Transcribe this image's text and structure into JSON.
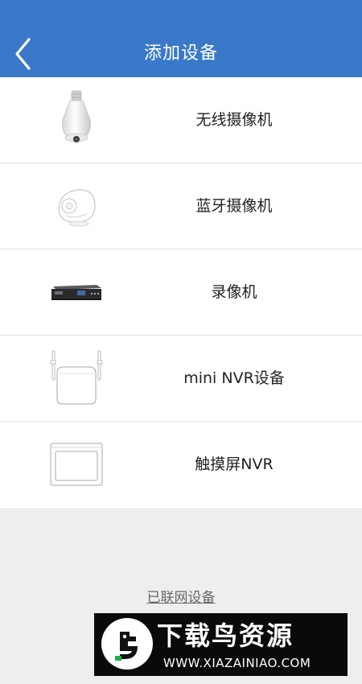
{
  "header": {
    "title": "添加设备",
    "back_icon": "chevron-left-icon",
    "background_color": "#3a79c9"
  },
  "devices": [
    {
      "label": "无线摄像机",
      "icon": "bulb-camera-icon"
    },
    {
      "label": "蓝牙摄像机",
      "icon": "dome-camera-icon"
    },
    {
      "label": "录像机",
      "icon": "dvr-recorder-icon"
    },
    {
      "label": "mini NVR设备",
      "icon": "mini-nvr-router-icon"
    },
    {
      "label": "触摸屏NVR",
      "icon": "touchscreen-nvr-icon"
    }
  ],
  "footer": {
    "connected_devices_link": "已联网设备"
  },
  "watermark": {
    "title": "下载鸟资源",
    "url": "WWW.XIAZAINIAO.COM",
    "logo_icon": "bird-logo-icon"
  }
}
